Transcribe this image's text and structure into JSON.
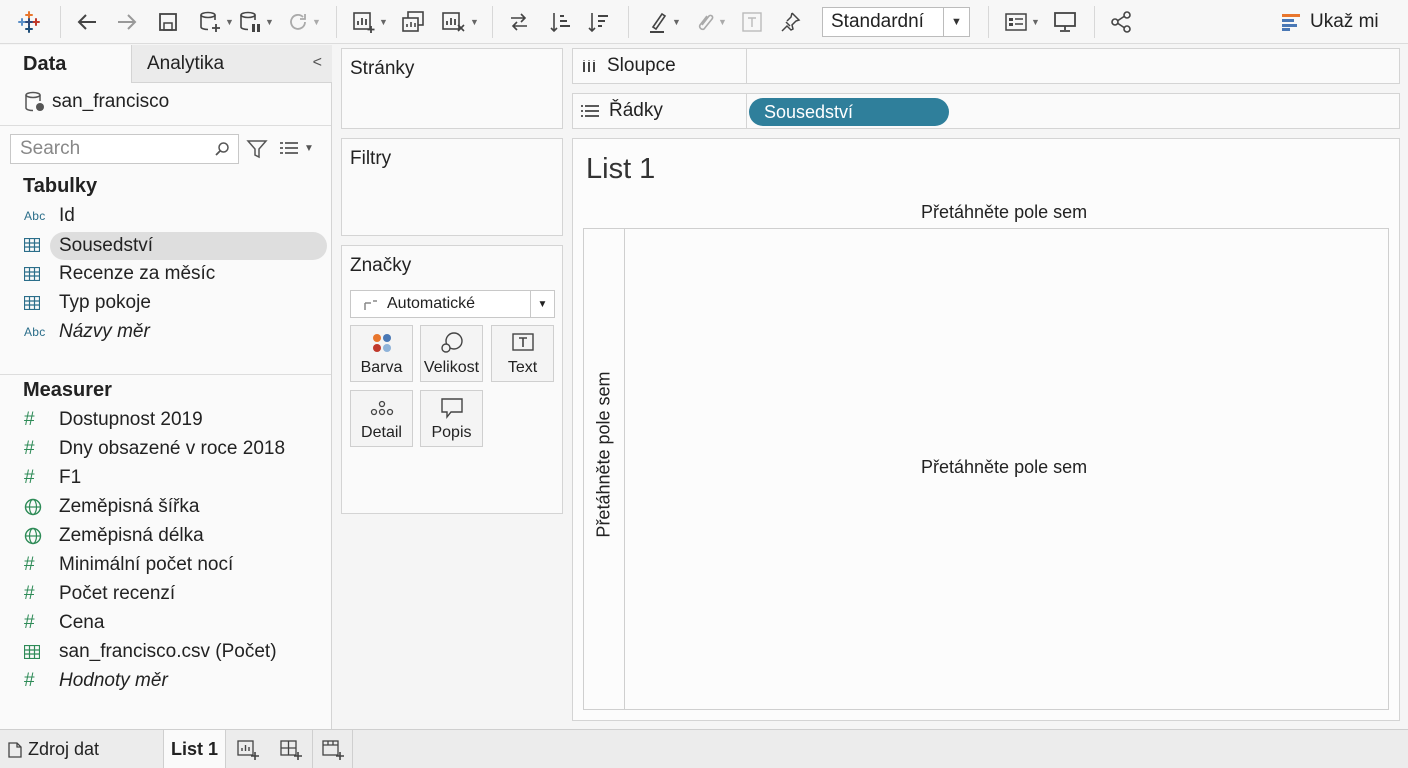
{
  "toolbar": {
    "format_select": "Standardní",
    "show_me_label": "Ukaž mi",
    "colors": {
      "logo_orange": "#e8762d",
      "logo_blue": "#1f4e79",
      "show_me_orange": "#e8762d",
      "show_me_blue": "#4a78b5"
    }
  },
  "left_panel": {
    "tab_data": "Data",
    "tab_analytics": "Analytika",
    "datasource": "san_francisco",
    "search_placeholder": "Search",
    "tables_header": "Tabulky",
    "tables": [
      {
        "icon": "abc-icon",
        "type_label": "Abc",
        "label": "Id",
        "italic": false
      },
      {
        "icon": "table-icon",
        "label": "Sousedství",
        "selected": true
      },
      {
        "icon": "table-icon",
        "label": "Recenze za měsíc"
      },
      {
        "icon": "table-icon",
        "label": "Typ pokoje"
      },
      {
        "icon": "abc-icon",
        "type_label": "Abc",
        "label": "Názvy měr",
        "italic": true
      }
    ],
    "measures_header": "Measurer",
    "measures": [
      {
        "icon": "hash-icon",
        "label": "Dostupnost 2019"
      },
      {
        "icon": "hash-icon",
        "label": "Dny obsazené v roce 2018"
      },
      {
        "icon": "hash-icon",
        "label": "F1"
      },
      {
        "icon": "globe-icon",
        "label": "Zeměpisná šířka"
      },
      {
        "icon": "globe-icon",
        "label": "Zeměpisná délka"
      },
      {
        "icon": "hash-icon",
        "label": "Minimální počet nocí"
      },
      {
        "icon": "hash-icon",
        "label": "Počet recenzí"
      },
      {
        "icon": "hash-icon",
        "label": "Cena"
      },
      {
        "icon": "table-icon",
        "label": "san_francisco.csv (Počet)"
      },
      {
        "icon": "hash-icon",
        "label": "Hodnoty měr",
        "italic": true
      }
    ]
  },
  "cards": {
    "pages": "Stránky",
    "filters": "Filtry",
    "marks": "Značky",
    "marks_type": "Automatické",
    "marks_buttons": [
      "Barva",
      "Velikost",
      "Text",
      "Detail",
      "Popis"
    ]
  },
  "shelves": {
    "columns_label": "Sloupce",
    "rows_label": "Řádky",
    "rows_pill": "Sousedství",
    "pill_color": "#2f7f9b"
  },
  "canvas": {
    "sheet_title": "List 1",
    "drop_top": "Přetáhněte pole sem",
    "drop_left": "Přetáhněte pole sem",
    "drop_center": "Přetáhněte pole sem"
  },
  "bottom": {
    "datasource_tab": "Zdroj dat",
    "sheet_tab": "List 1"
  }
}
